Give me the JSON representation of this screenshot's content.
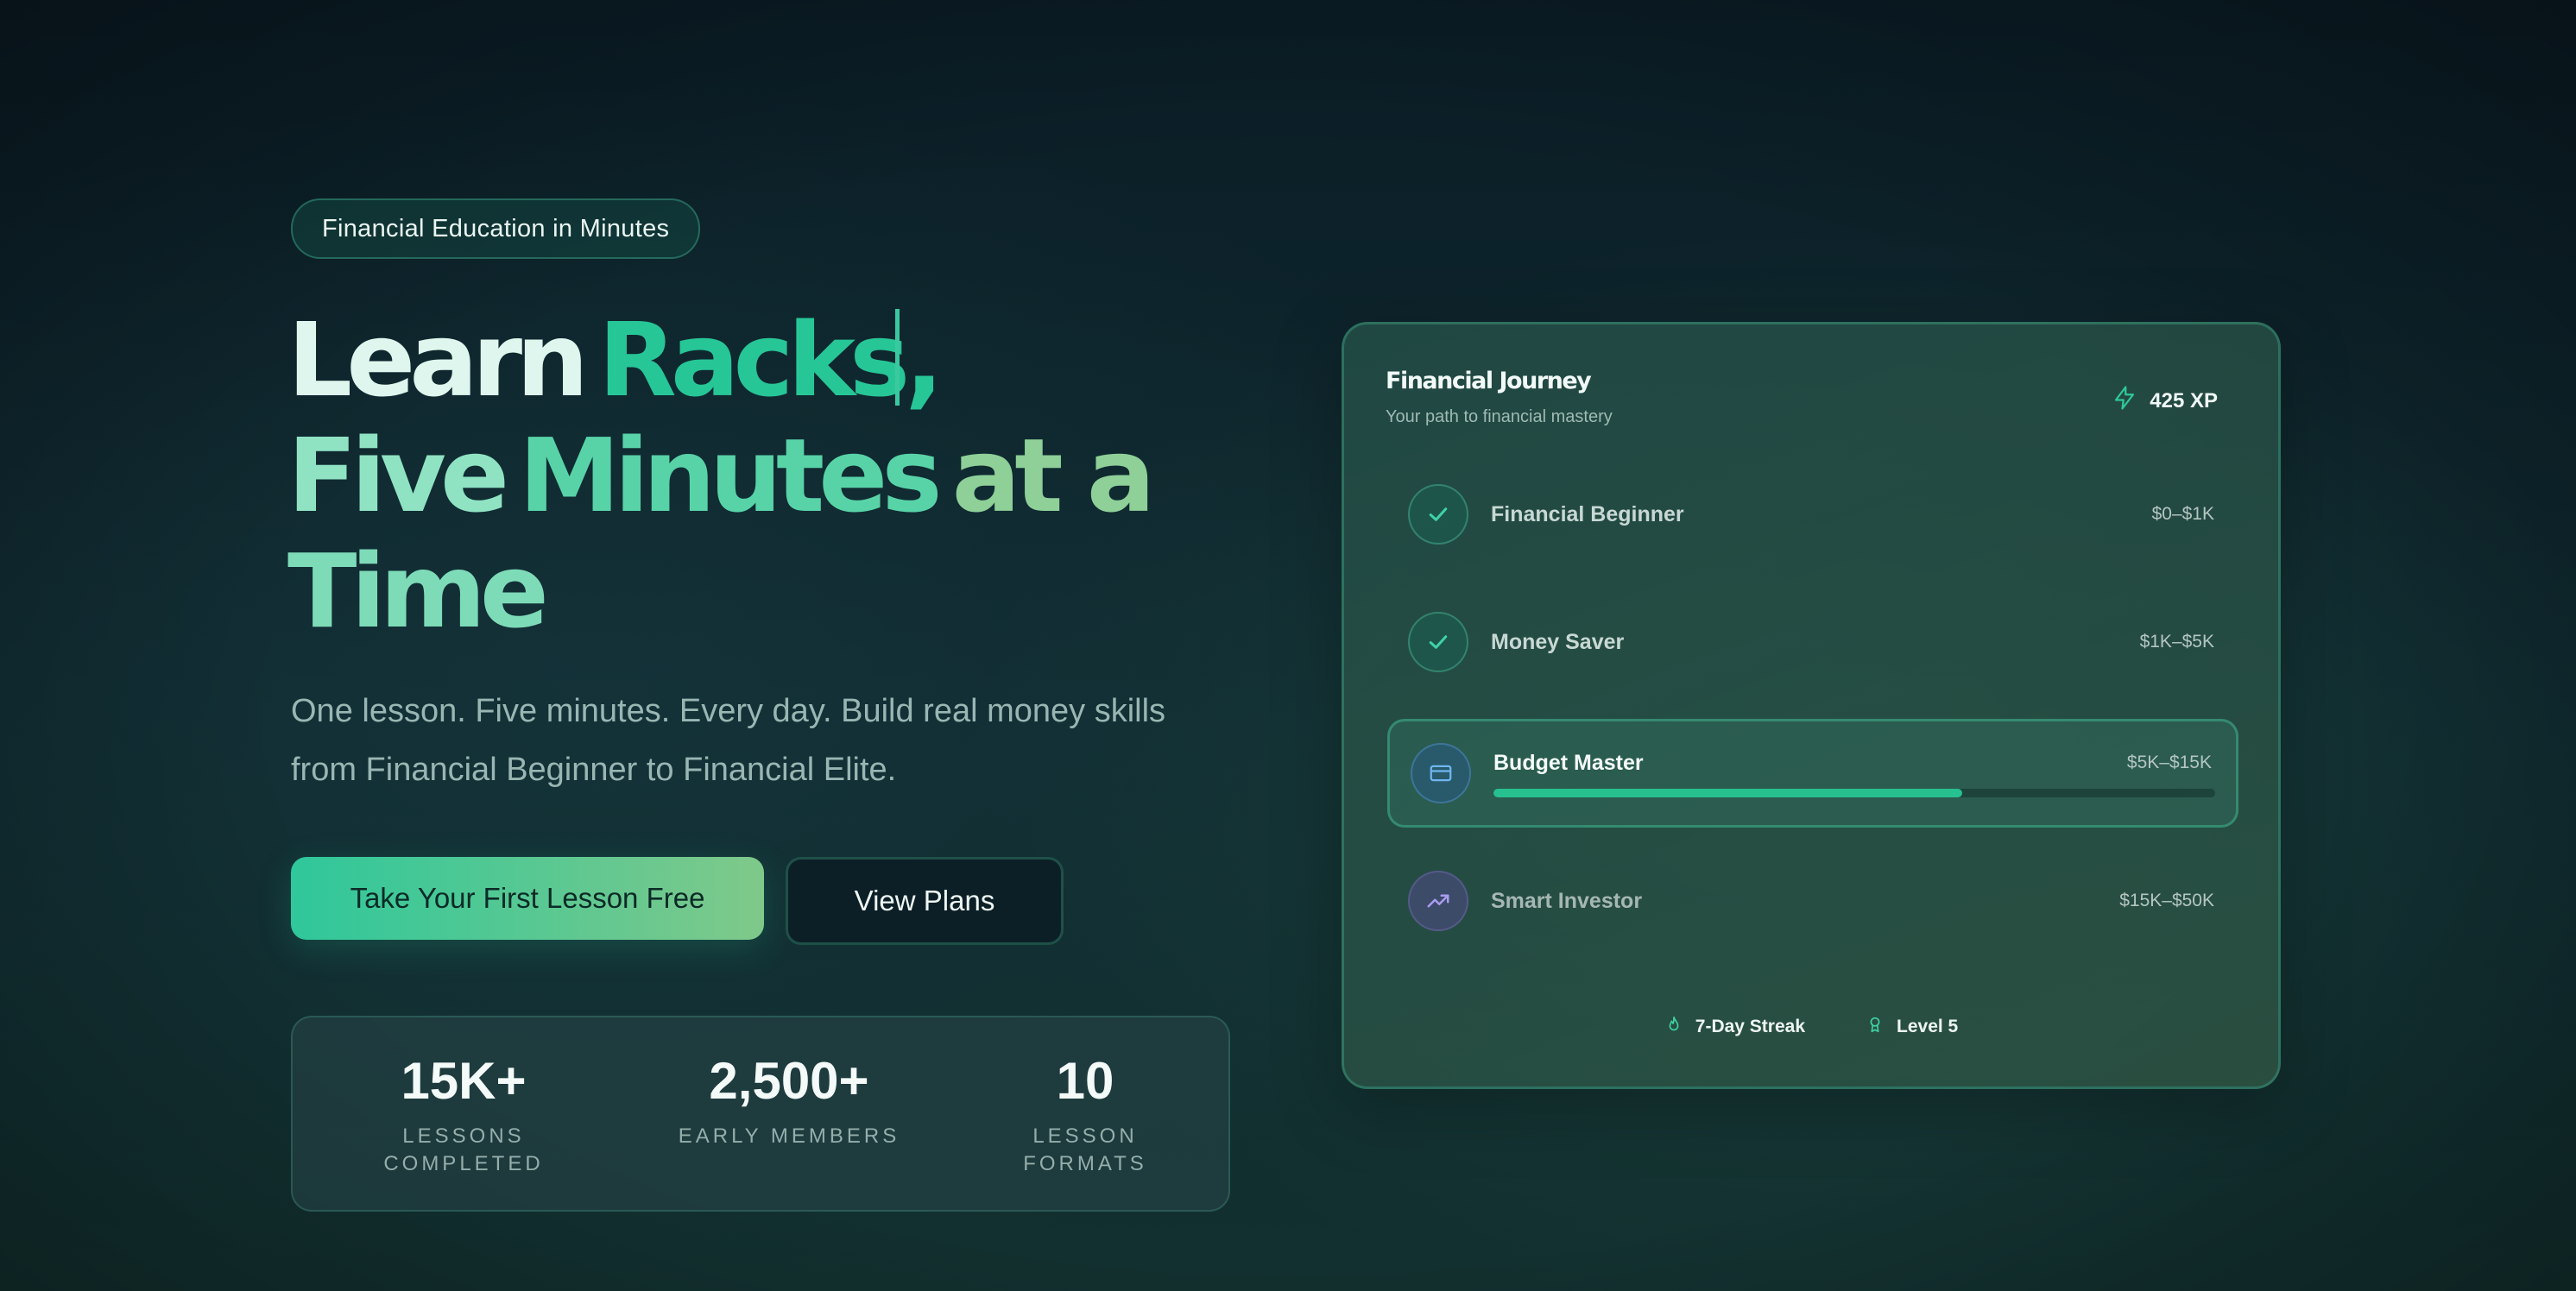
{
  "hero": {
    "badge": "Financial Education in Minutes",
    "headline": {
      "line1": [
        "Learn",
        "Racks",
        ","
      ],
      "line2": [
        "Five",
        "Minutes",
        "at a"
      ],
      "line3": [
        "Time"
      ]
    },
    "subtitle": "One lesson. Five minutes. Every day. Build real money skills from Financial Beginner to Financial Elite.",
    "primary_cta": "Take Your First Lesson Free",
    "secondary_cta": "View Plans"
  },
  "stats": [
    {
      "value": "15K+",
      "label": "LESSONS COMPLETED"
    },
    {
      "value": "2,500+",
      "label": "EARLY MEMBERS"
    },
    {
      "value": "10",
      "label": "LESSON FORMATS"
    }
  ],
  "journey": {
    "title": "Financial Journey",
    "subtitle": "Your path to financial mastery",
    "xp": "425 XP",
    "xp_icon": "lightning-icon",
    "levels": [
      {
        "name": "Financial Beginner",
        "range": "$0–$1K",
        "status": "completed",
        "icon": "check-icon"
      },
      {
        "name": "Money Saver",
        "range": "$1K–$5K",
        "status": "completed",
        "icon": "check-icon"
      },
      {
        "name": "Budget Master",
        "range": "$5K–$15K",
        "status": "active",
        "icon": "credit-card-icon",
        "progress": 0.65
      },
      {
        "name": "Smart Investor",
        "range": "$15K–$50K",
        "status": "locked",
        "icon": "trending-up-icon"
      }
    ],
    "footer": {
      "streak": "7-Day Streak",
      "streak_icon": "flame-icon",
      "level": "Level 5",
      "level_icon": "award-icon"
    }
  },
  "colors": {
    "accent": "#27c697",
    "background": "#0f2a30",
    "progress": "#27c08f"
  }
}
